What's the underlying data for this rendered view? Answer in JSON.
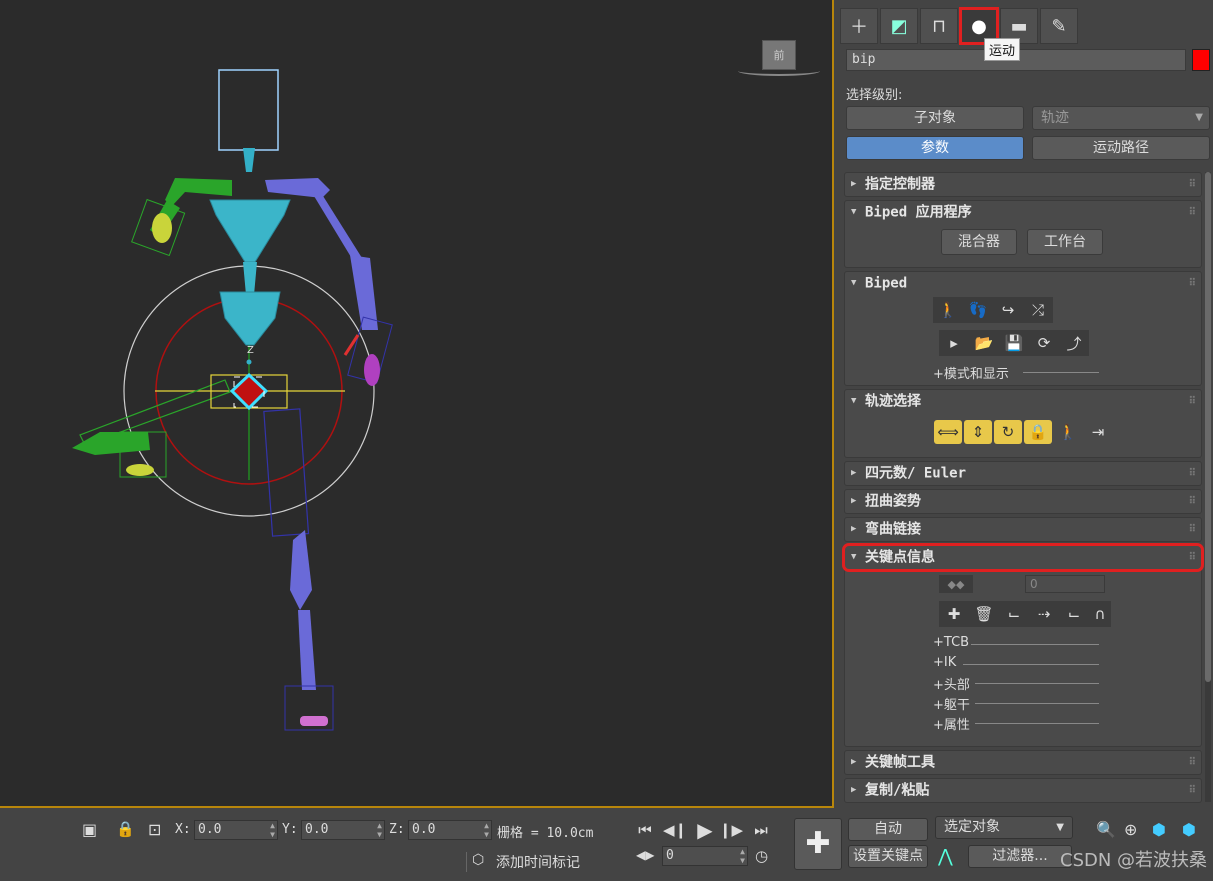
{
  "panel": {
    "tabs": [
      {
        "icon": "plus-icon",
        "glyph": "＋"
      },
      {
        "icon": "modify-icon",
        "glyph": "◩"
      },
      {
        "icon": "hierarchy-icon",
        "glyph": "⊓"
      },
      {
        "icon": "motion-icon",
        "glyph": "●"
      },
      {
        "icon": "display-icon",
        "glyph": "▬"
      },
      {
        "icon": "utilities-icon",
        "glyph": "🔧"
      }
    ],
    "tooltip": "运动",
    "object_name": "bip",
    "object_color": "#ff0000",
    "selection_level_label": "选择级别:",
    "sub_object_button": "子对象",
    "trajectory_dropdown": "轨迹",
    "params_button": "参数",
    "motion_paths_button": "运动路径",
    "rollouts": {
      "assign_controller": "指定控制器",
      "biped_apps": "Biped 应用程序",
      "mixer": "混合器",
      "workbench": "工作台",
      "biped": "Biped",
      "mode_display": "+模式和显示",
      "track_selection": "轨迹选择",
      "quaternion": "四元数/ Euler",
      "twist_poses": "扭曲姿势",
      "bend_links": "弯曲链接",
      "key_info": "关键点信息",
      "key_spinner": "0",
      "key_subs": [
        "+TCB",
        "+IK",
        "+头部",
        "+躯干",
        "+属性"
      ],
      "keyframe_tools": "关键帧工具",
      "copy_paste": "复制/粘贴"
    }
  },
  "viewport": {
    "cube_label": "前",
    "axis_label": "Z"
  },
  "bottom": {
    "x_label": "X:",
    "y_label": "Y:",
    "z_label": "Z:",
    "x_value": "0.0",
    "y_value": "0.0",
    "z_value": "0.0",
    "grid_label": "栅格 = 10.0cm",
    "add_time_tag": "添加时间标记",
    "frame_value": "0",
    "auto_button": "自动",
    "selected_dropdown": "选定对象",
    "set_key_button": "设置关键点",
    "filters_button": "过滤器...",
    "watermark": "CSDN @若波扶桑"
  }
}
